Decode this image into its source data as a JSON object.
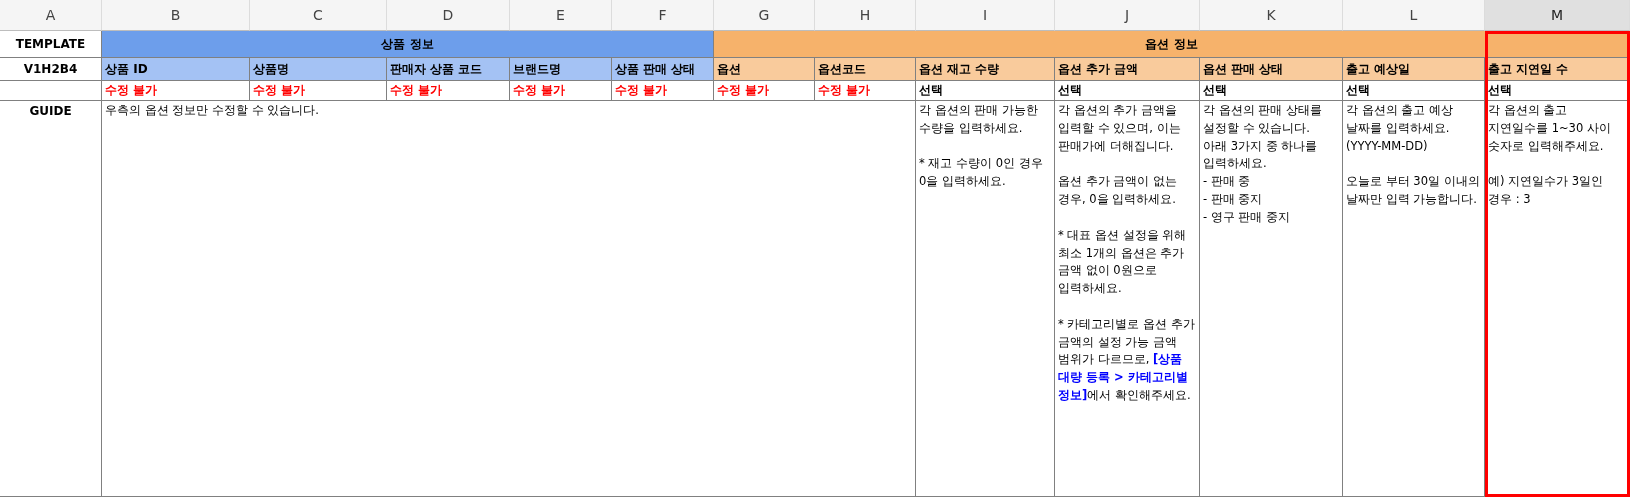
{
  "columns": [
    {
      "letter": "A",
      "selected": false
    },
    {
      "letter": "B",
      "selected": false
    },
    {
      "letter": "C",
      "selected": false
    },
    {
      "letter": "D",
      "selected": false
    },
    {
      "letter": "E",
      "selected": false
    },
    {
      "letter": "F",
      "selected": false
    },
    {
      "letter": "G",
      "selected": false
    },
    {
      "letter": "H",
      "selected": false
    },
    {
      "letter": "I",
      "selected": false
    },
    {
      "letter": "J",
      "selected": false
    },
    {
      "letter": "K",
      "selected": false
    },
    {
      "letter": "L",
      "selected": false
    },
    {
      "letter": "M",
      "selected": true
    }
  ],
  "template_row": {
    "label": "TEMPLATE",
    "groups": [
      {
        "title": "상품 정보",
        "kind": "product"
      },
      {
        "title": "옵션 정보",
        "kind": "option"
      }
    ]
  },
  "header_row": {
    "label": "V1H2B4",
    "fields": [
      {
        "name": "상품 ID",
        "kind": "product"
      },
      {
        "name": "상품명",
        "kind": "product"
      },
      {
        "name": "판매자 상품 코드",
        "kind": "product"
      },
      {
        "name": "브랜드명",
        "kind": "product"
      },
      {
        "name": "상품 판매 상태",
        "kind": "product"
      },
      {
        "name": "옵션",
        "kind": "option"
      },
      {
        "name": "옵션코드",
        "kind": "option"
      },
      {
        "name": "옵션 재고 수량",
        "kind": "option"
      },
      {
        "name": "옵션 추가 금액",
        "kind": "option"
      },
      {
        "name": "옵션 판매 상태",
        "kind": "option"
      },
      {
        "name": "출고 예상일",
        "kind": "option"
      },
      {
        "name": "출고 지연일 수",
        "kind": "option"
      }
    ]
  },
  "edit_row": {
    "cells": [
      {
        "text": "수정 불가",
        "kind": "locked"
      },
      {
        "text": "수정 불가",
        "kind": "locked"
      },
      {
        "text": "수정 불가",
        "kind": "locked"
      },
      {
        "text": "수정 불가",
        "kind": "locked"
      },
      {
        "text": "수정 불가",
        "kind": "locked"
      },
      {
        "text": "수정 불가",
        "kind": "locked"
      },
      {
        "text": "수정 불가",
        "kind": "locked"
      },
      {
        "text": "선택",
        "kind": "optional"
      },
      {
        "text": "선택",
        "kind": "optional"
      },
      {
        "text": "선택",
        "kind": "optional"
      },
      {
        "text": "선택",
        "kind": "optional"
      },
      {
        "text": "선택",
        "kind": "optional"
      }
    ]
  },
  "guide_row": {
    "label": "GUIDE",
    "cells": [
      {
        "text": "우측의 옵션 정보만 수정할 수 있습니다."
      },
      {
        "text": "각 옵션의 판매 가능한 수량을 입력하세요.\n\n * 재고 수량이 0인 경우 0을 입력하세요."
      },
      {
        "text": "각 옵션의 추가 금액을 입력할 수 있으며, 이는 판매가에 더해집니다.\n\n옵션 추가 금액이 없는 경우, 0을 입력하세요.\n\n* 대표 옵션 설정을 위해 최소 1개의 옵션은 추가 금액 없이 0원으로 입력하세요.\n\n* 카테고리별로 옵션 추가 금액의 설정 가능 금액 범위가 다르므로, **[상품 대량 등록 > 카테고리별 정보]**에서 확인해주세요."
      },
      {
        "text": "각 옵션의 판매 상태를 설정할 수 있습니다.\n아래 3가지 중 하나를 입력하세요.\n- 판매 중\n- 판매 중지\n- 영구 판매 중지"
      },
      {
        "text": "각 옵션의 출고 예상 날짜를 입력하세요.\n(YYYY-MM-DD)\n\n오늘로 부터 30일 이내의 날짜만 입력 가능합니다."
      },
      {
        "text": "각 옵션의 출고 지연일수를 1~30 사이 숫자로 입력해주세요.\n\n예) 지연일수가 3일인 경우 : 3"
      }
    ]
  }
}
